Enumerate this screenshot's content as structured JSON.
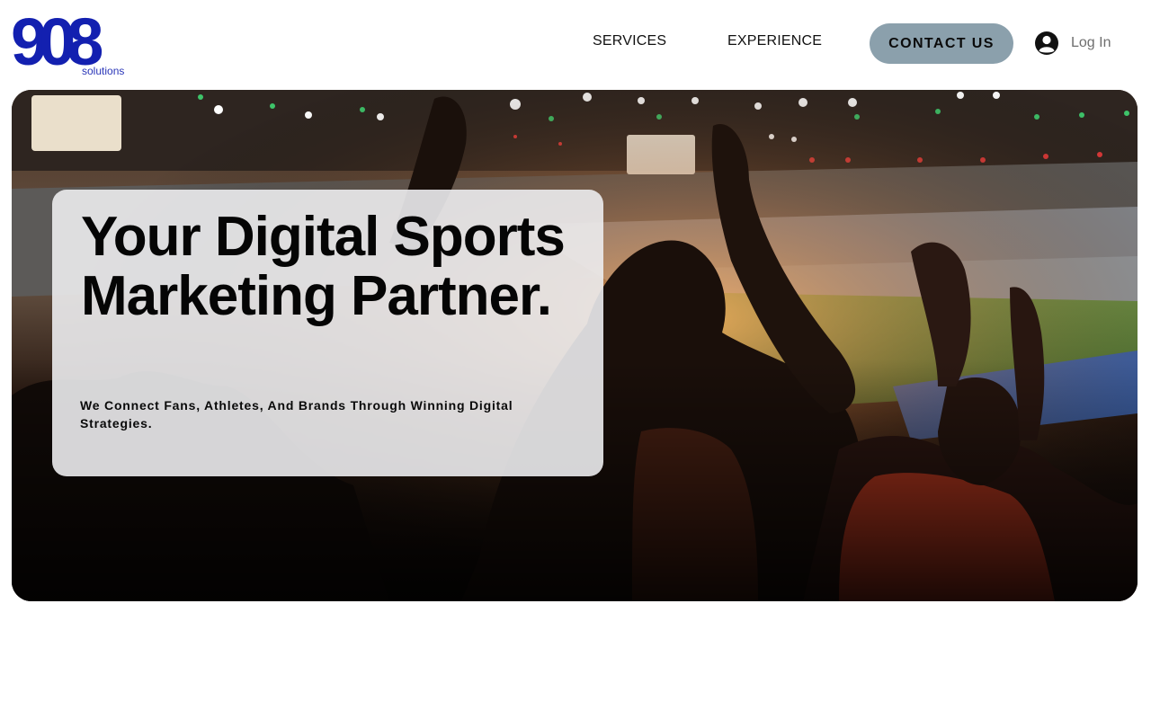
{
  "brand": {
    "logo_text": "908",
    "logo_subtext": "solutions",
    "logo_color": "#1320b0"
  },
  "nav": {
    "items": [
      {
        "label": "SERVICES"
      },
      {
        "label": "EXPERIENCE"
      }
    ],
    "contact_label": "CONTACT US",
    "contact_color": "#8ba0ac",
    "login_label": "Log In",
    "login_icon": "user-avatar-icon"
  },
  "hero": {
    "image": "stadium-crowd-photo",
    "title": "Your Digital Sports Marketing Partner.",
    "subtitle": "We Connect Fans, Athletes, And Brands Through Winning Digital Strategies."
  }
}
